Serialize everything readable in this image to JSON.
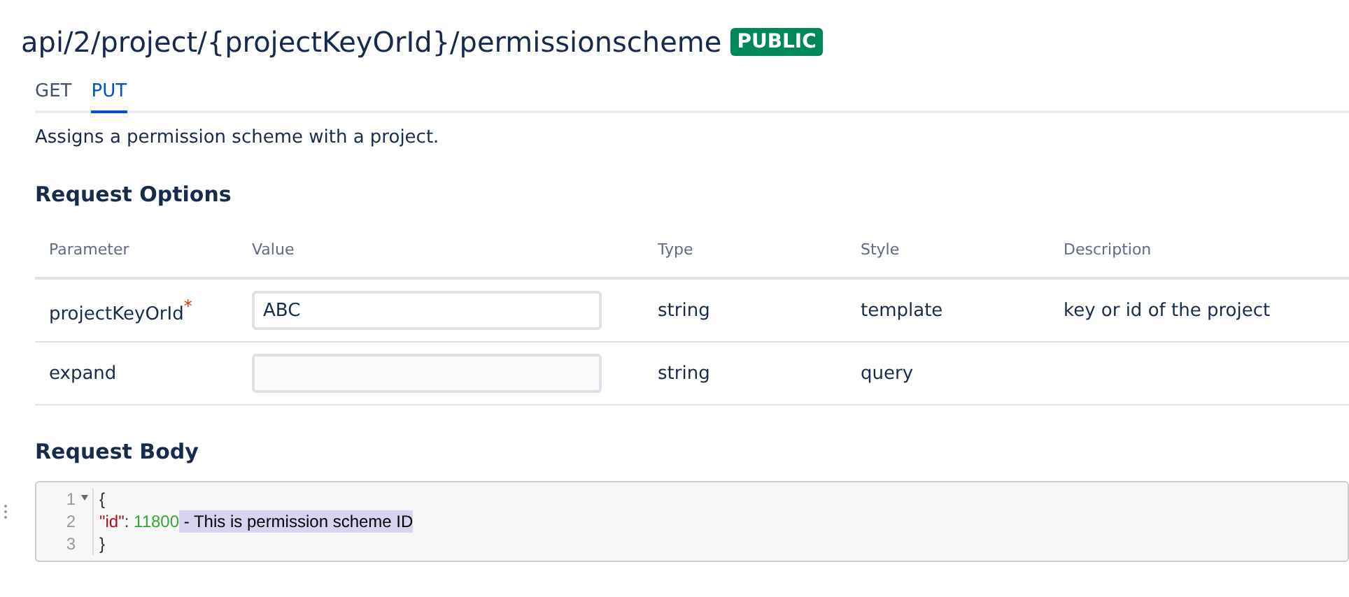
{
  "title": "api/2/project/{projectKeyOrId}/permissionscheme",
  "badge": "PUBLIC",
  "tabs": [
    {
      "label": "GET",
      "selected": false
    },
    {
      "label": "PUT",
      "selected": true
    }
  ],
  "description": "Assigns a permission scheme with a project.",
  "request_options": {
    "heading": "Request Options",
    "columns": [
      "Parameter",
      "Value",
      "Type",
      "Style",
      "Description"
    ],
    "rows": [
      {
        "parameter": "projectKeyOrId",
        "required": true,
        "required_mark": "*",
        "value": "ABC",
        "type": "string",
        "style": "template",
        "description": "key or id of the project"
      },
      {
        "parameter": "expand",
        "required": false,
        "type": "string",
        "style": "query"
      }
    ]
  },
  "request_body": {
    "heading": "Request Body",
    "lines": [
      {
        "number": "1",
        "foldable": true,
        "tokens": [
          {
            "kind": "punct",
            "text": "{"
          }
        ]
      },
      {
        "number": "2",
        "foldable": false,
        "tokens": [
          {
            "kind": "key",
            "text": "\"id\""
          },
          {
            "kind": "punct",
            "text": ": "
          },
          {
            "kind": "number",
            "text": "11800"
          },
          {
            "kind": "selected",
            "text": " - This is permission scheme ID"
          }
        ]
      },
      {
        "number": "3",
        "foldable": false,
        "tokens": [
          {
            "kind": "punct",
            "text": "}"
          }
        ]
      }
    ]
  }
}
